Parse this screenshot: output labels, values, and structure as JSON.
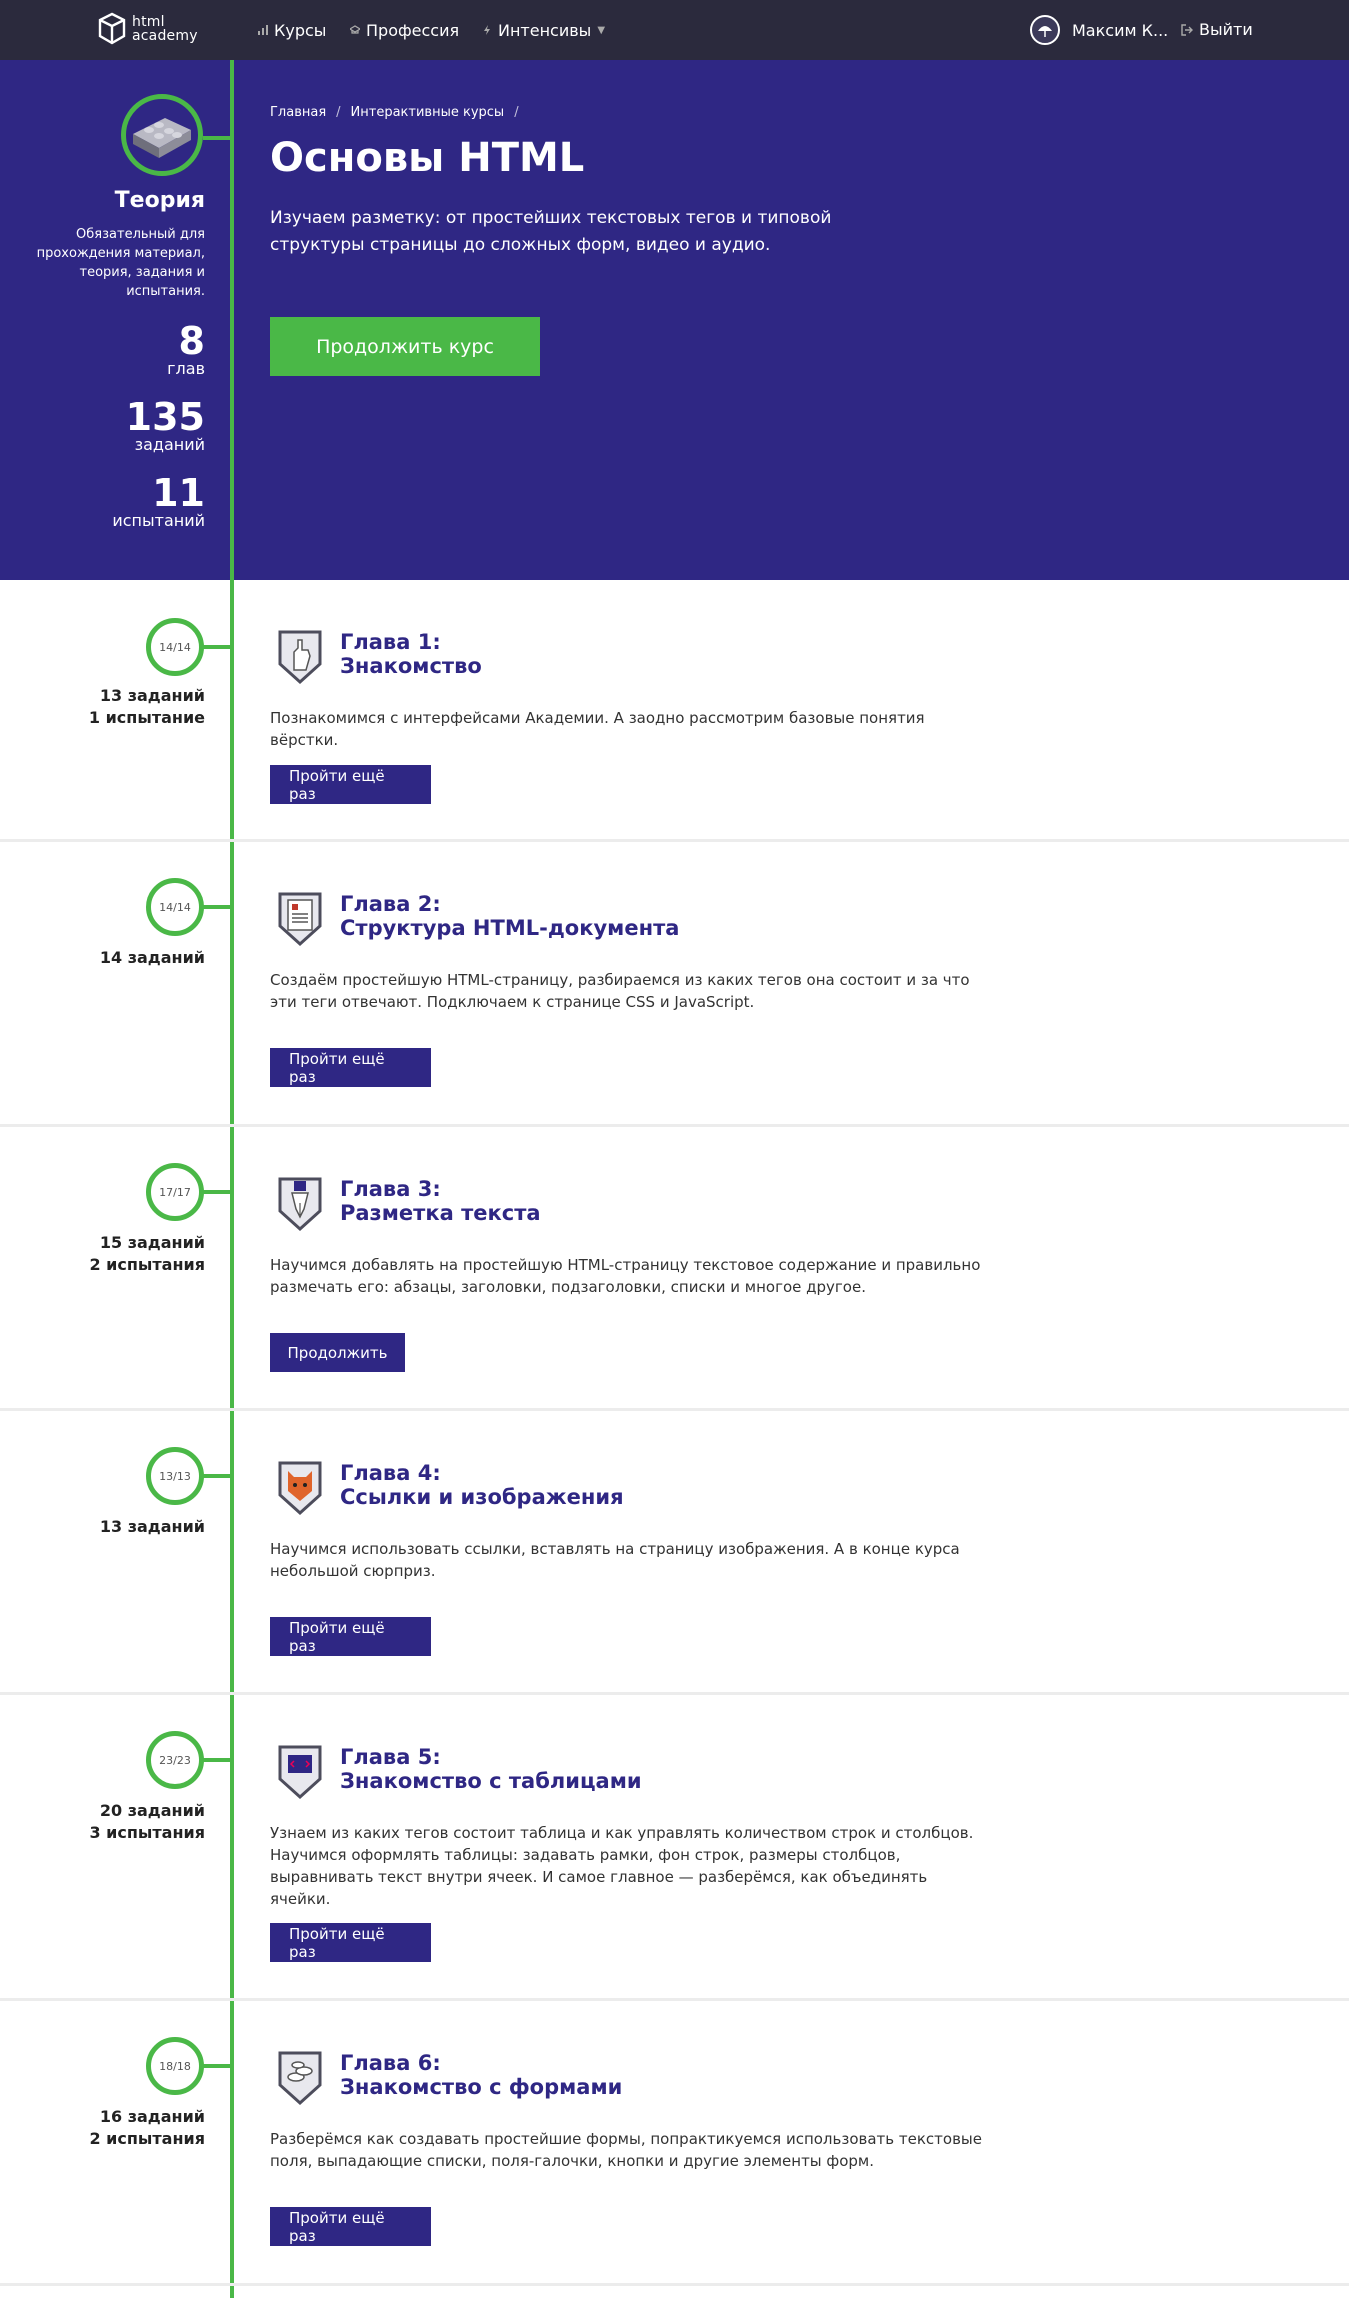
{
  "nav": {
    "logo_line1": "html",
    "logo_line2": "academy",
    "items": [
      {
        "label": "Курсы",
        "icon": "bars-icon"
      },
      {
        "label": "Профессия",
        "icon": "cap-icon"
      },
      {
        "label": "Интенсивы",
        "icon": "lightning-icon"
      }
    ],
    "user_name": "Максим К...",
    "logout": "Выйти"
  },
  "hero": {
    "side": {
      "title": "Теория",
      "description": "Обязательный для прохождения материал, теория, задания и испытания.",
      "stats": [
        {
          "num": "8",
          "label": "глав"
        },
        {
          "num": "135",
          "label": "заданий"
        },
        {
          "num": "11",
          "label": "испытаний"
        }
      ]
    },
    "breadcrumbs": [
      "Главная",
      "Интерактивные курсы"
    ],
    "title": "Основы HTML",
    "description": "Изучаем разметку: от простейших текстовых тегов и типовой структуры страницы до сложных форм, видео и аудио.",
    "button": "Продолжить курс"
  },
  "colors": {
    "hero_bg": "#2f2784",
    "accent_green": "#4ab847",
    "nav_bg": "#2b2a3d"
  },
  "chapters": [
    {
      "progress": "14/14",
      "stats_line1": "13 заданий",
      "stats_line2": "1 испытание",
      "title1": "Глава 1:",
      "title2": "Знакомство",
      "description": "Познакомимся с интерфейсами Академии. А заодно рассмотрим базовые понятия вёрстки.",
      "button": "Пройти ещё раз",
      "icon": "hand-icon"
    },
    {
      "progress": "14/14",
      "stats_line1": "14 заданий",
      "stats_line2": "",
      "title1": "Глава 2:",
      "title2": "Структура HTML-документа",
      "description": "Создаём простейшую HTML-страницу, разбираемся из каких тегов она состоит и за что эти теги отвечают. Подключаем к странице CSS и JavaScript.",
      "button": "Пройти ещё раз",
      "icon": "document-icon"
    },
    {
      "progress": "17/17",
      "stats_line1": "15 заданий",
      "stats_line2": "2 испытания",
      "title1": "Глава 3:",
      "title2": "Разметка текста",
      "description": "Научимся добавлять на простейшую HTML-страницу текстовое содержание и правильно размечать его: абзацы, заголовки, подзаголовки, списки и многое другое.",
      "button": "Продолжить",
      "icon": "pen-nib-icon"
    },
    {
      "progress": "13/13",
      "stats_line1": "13 заданий",
      "stats_line2": "",
      "title1": "Глава 4:",
      "title2": "Ссылки и изображения",
      "description": "Научимся использовать ссылки, вставлять на страницу изображения. А в конце курса небольшой сюрприз.",
      "button": "Пройти ещё раз",
      "icon": "cat-icon"
    },
    {
      "progress": "23/23",
      "stats_line1": "20 заданий",
      "stats_line2": "3 испытания",
      "title1": "Глава 5:",
      "title2": "Знакомство с таблицами",
      "description": "Узнаем из каких тегов состоит таблица и как управлять количеством строк и столбцов. Научимся оформлять таблицы: задавать рамки, фон строк, размеры столбцов, выравнивать текст внутри ячеек. И самое главное — разберёмся, как объединять ячейки.",
      "button": "Пройти ещё раз",
      "icon": "code-screen-icon"
    },
    {
      "progress": "18/18",
      "stats_line1": "16 заданий",
      "stats_line2": "2 испытания",
      "title1": "Глава 6:",
      "title2": "Знакомство с формами",
      "description": "Разберёмся как создавать простейшие формы, попрактикуемся использовать текстовые поля, выпадающие списки, поля-галочки, кнопки и другие элементы форм.",
      "button": "Пройти ещё раз",
      "icon": "coins-icon"
    }
  ]
}
